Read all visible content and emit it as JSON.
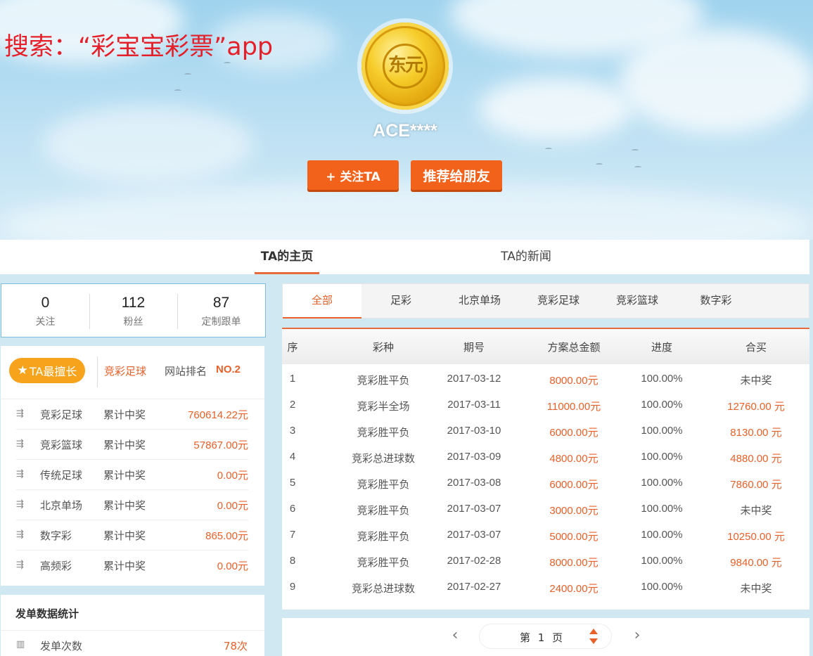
{
  "promo": "搜索：“彩宝宝彩票”app",
  "profile": {
    "medal_text": "东元",
    "username": "ACE****",
    "follow_label": "+ 关注TA",
    "recommend_label": "推荐给朋友"
  },
  "main_tabs": [
    {
      "label": "TA的主页",
      "active": true
    },
    {
      "label": "TA的新闻",
      "active": false
    }
  ],
  "stats": [
    {
      "value": "0",
      "label": "关注"
    },
    {
      "value": "112",
      "label": "粉丝"
    },
    {
      "value": "87",
      "label": "定制跟单"
    }
  ],
  "best": {
    "badge": "TA最擅长",
    "category": "竞彩足球",
    "rank_label": "网站排名",
    "rank": "NO.2"
  },
  "prizes": [
    {
      "name": "竞彩足球",
      "label": "累计中奖",
      "amount": "760614.22元"
    },
    {
      "name": "竞彩篮球",
      "label": "累计中奖",
      "amount": "57867.00元"
    },
    {
      "name": "传统足球",
      "label": "累计中奖",
      "amount": "0.00元"
    },
    {
      "name": "北京单场",
      "label": "累计中奖",
      "amount": "0.00元"
    },
    {
      "name": "数字彩",
      "label": "累计中奖",
      "amount": "865.00元"
    },
    {
      "name": "高频彩",
      "label": "累计中奖",
      "amount": "0.00元"
    }
  ],
  "send_stats": {
    "title": "发单数据统计",
    "label": "发单次数",
    "value": "78次"
  },
  "sub_tabs": [
    {
      "label": "全部",
      "active": true
    },
    {
      "label": "足彩",
      "active": false
    },
    {
      "label": "北京单场",
      "active": false
    },
    {
      "label": "竞彩足球",
      "active": false
    },
    {
      "label": "竞彩篮球",
      "active": false
    },
    {
      "label": "数字彩",
      "active": false
    }
  ],
  "table": {
    "headers": [
      "序",
      "彩种",
      "期号",
      "方案总金额",
      "进度",
      "合买"
    ],
    "rows": [
      {
        "no": "1",
        "type": "竞彩胜平负",
        "issue": "2017-03-12",
        "amount": "8000.00元",
        "progress": "100.00%",
        "result": "未中奖"
      },
      {
        "no": "2",
        "type": "竞彩半全场",
        "issue": "2017-03-11",
        "amount": "11000.00元",
        "progress": "100.00%",
        "result": "12760.00 元"
      },
      {
        "no": "3",
        "type": "竞彩胜平负",
        "issue": "2017-03-10",
        "amount": "6000.00元",
        "progress": "100.00%",
        "result": "8130.00 元"
      },
      {
        "no": "4",
        "type": "竞彩总进球数",
        "issue": "2017-03-09",
        "amount": "4800.00元",
        "progress": "100.00%",
        "result": "4880.00 元"
      },
      {
        "no": "5",
        "type": "竞彩胜平负",
        "issue": "2017-03-08",
        "amount": "6000.00元",
        "progress": "100.00%",
        "result": "7860.00 元"
      },
      {
        "no": "6",
        "type": "竞彩胜平负",
        "issue": "2017-03-07",
        "amount": "3000.00元",
        "progress": "100.00%",
        "result": "未中奖"
      },
      {
        "no": "7",
        "type": "竞彩胜平负",
        "issue": "2017-03-07",
        "amount": "5000.00元",
        "progress": "100.00%",
        "result": "10250.00 元"
      },
      {
        "no": "8",
        "type": "竞彩胜平负",
        "issue": "2017-02-28",
        "amount": "8000.00元",
        "progress": "100.00%",
        "result": "9840.00 元"
      },
      {
        "no": "9",
        "type": "竞彩总进球数",
        "issue": "2017-02-27",
        "amount": "2400.00元",
        "progress": "100.00%",
        "result": "未中奖"
      }
    ]
  },
  "pager": {
    "page_text": "第 1 页",
    "prev_icon": "chevron-left-icon",
    "next_icon": "chevron-right-icon"
  },
  "colors": {
    "accent": "#e8602a",
    "button": "#f2621a",
    "badge": "#f7a31c",
    "promo": "#e5202a"
  }
}
